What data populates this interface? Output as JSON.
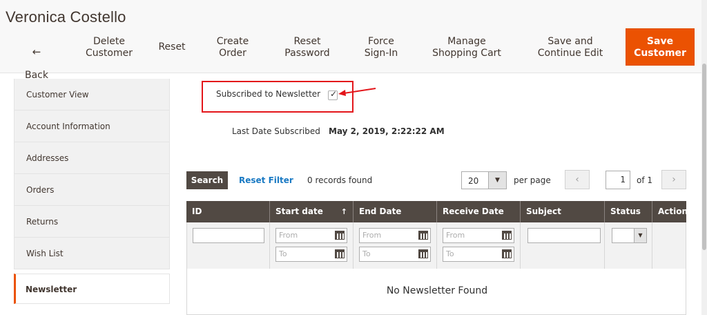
{
  "header": {
    "title": "Veronica Costello",
    "buttons": {
      "back": "Back",
      "delete": "Delete\nCustomer",
      "reset": "Reset",
      "create_order": "Create\nOrder",
      "reset_password": "Reset\nPassword",
      "force_signin": "Force\nSign-In",
      "manage_cart": "Manage\nShopping Cart",
      "save_continue": "Save and\nContinue Edit",
      "save_customer": "Save\nCustomer"
    },
    "back_arrow": "←"
  },
  "sidebar": {
    "items": [
      {
        "label": "Customer View"
      },
      {
        "label": "Account Information"
      },
      {
        "label": "Addresses"
      },
      {
        "label": "Orders"
      },
      {
        "label": "Returns"
      },
      {
        "label": "Wish List"
      },
      {
        "label": "Newsletter",
        "active": true
      }
    ]
  },
  "newsletter": {
    "subscribed_label": "Subscribed to Newsletter",
    "subscribed_checked": true,
    "check_glyph": "✓",
    "last_date_label": "Last Date Subscribed",
    "last_date_value": "May 2, 2019, 2:22:22 AM"
  },
  "grid_controls": {
    "search_label": "Search",
    "reset_filter_label": "Reset Filter",
    "records_found": "0 records found",
    "per_page_value": "20",
    "per_page_label": "per page",
    "page_value": "1",
    "of_label": "of 1",
    "prev_glyph": "‹",
    "next_glyph": "›"
  },
  "grid": {
    "columns": [
      "ID",
      "Start date",
      "End Date",
      "Receive Date",
      "Subject",
      "Status",
      "Action"
    ],
    "sort_glyph": "↑",
    "filter_placeholders": {
      "from": "From",
      "to": "To"
    },
    "empty_message": "No Newsletter Found"
  },
  "colors": {
    "accent": "#eb5202",
    "header_dark": "#514943",
    "link": "#1979c3",
    "highlight_box": "#e3151a"
  }
}
